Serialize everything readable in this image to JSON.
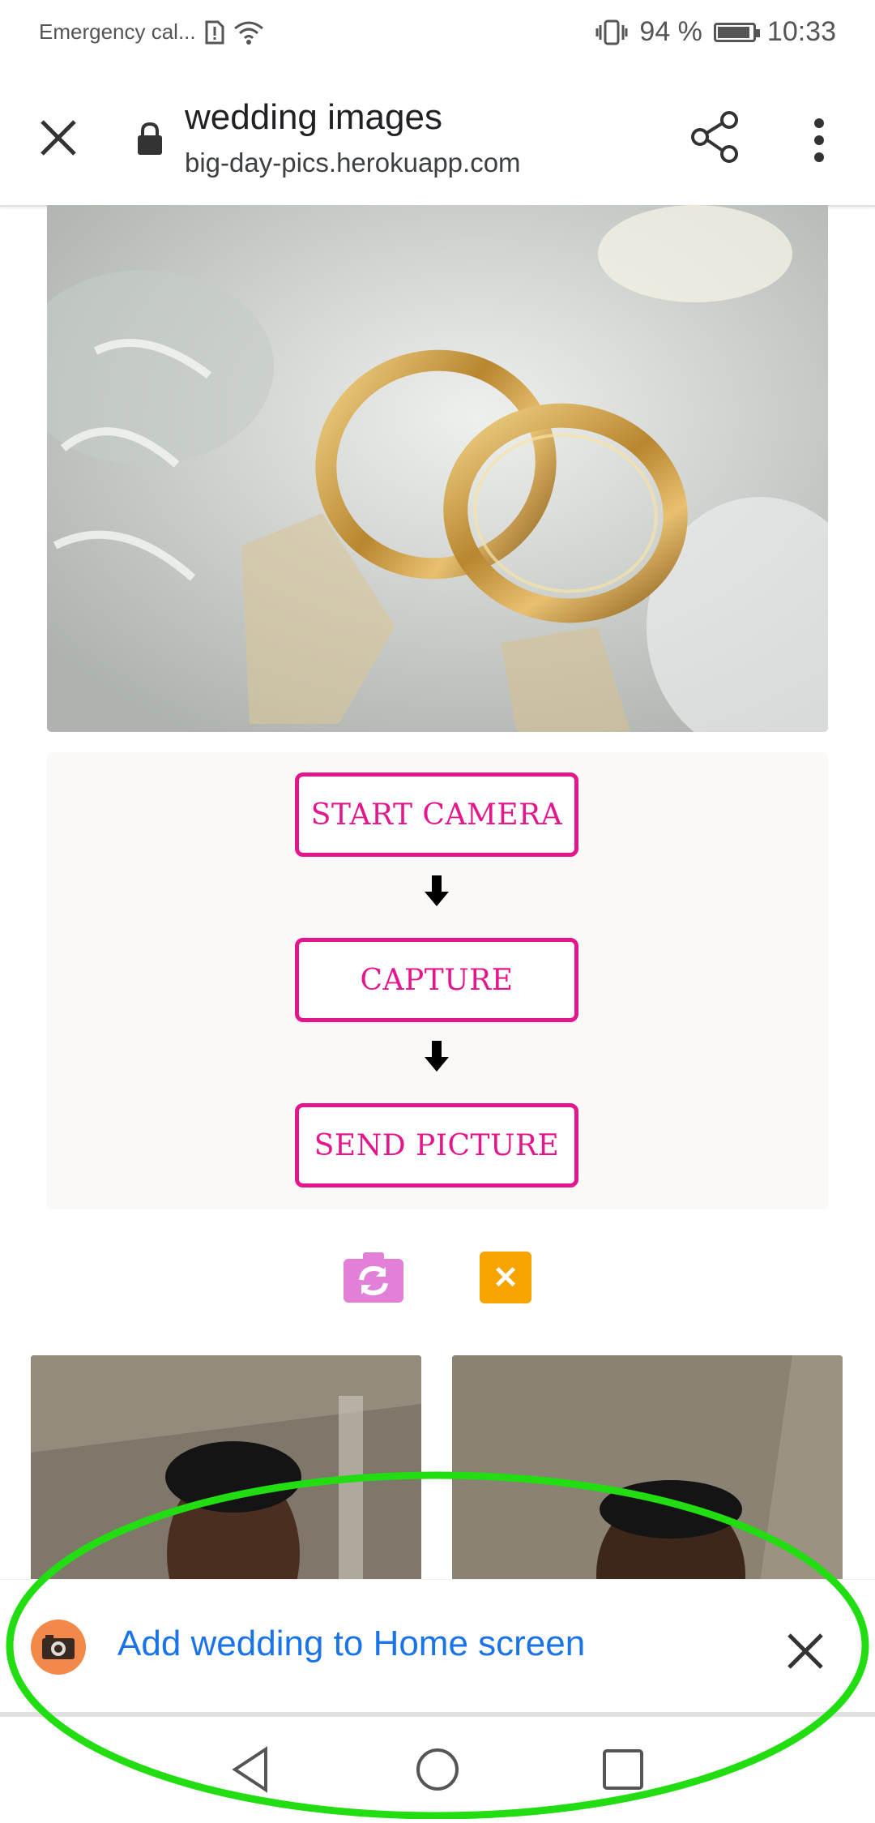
{
  "status_bar": {
    "carrier": "Emergency cal...",
    "battery_percent": "94 %",
    "battery_level": 0.94,
    "time": "10:33"
  },
  "browser": {
    "title": "wedding images",
    "url": "big-day-pics.herokuapp.com"
  },
  "steps": {
    "start_camera": "START CAMERA",
    "capture": "CAPTURE",
    "send_picture": "SEND PICTURE"
  },
  "colors": {
    "accent_pink": "#e4168b",
    "flip_camera": "#e27fd6",
    "close_orange": "#f7a300",
    "link_blue": "#1a73e8",
    "annotation_green": "#22dd11"
  },
  "add_to_home": {
    "label": "Add wedding to Home screen"
  },
  "icons": {
    "flip_camera": "camera-rotate-icon",
    "close": "close-icon",
    "app": "camera-icon"
  }
}
